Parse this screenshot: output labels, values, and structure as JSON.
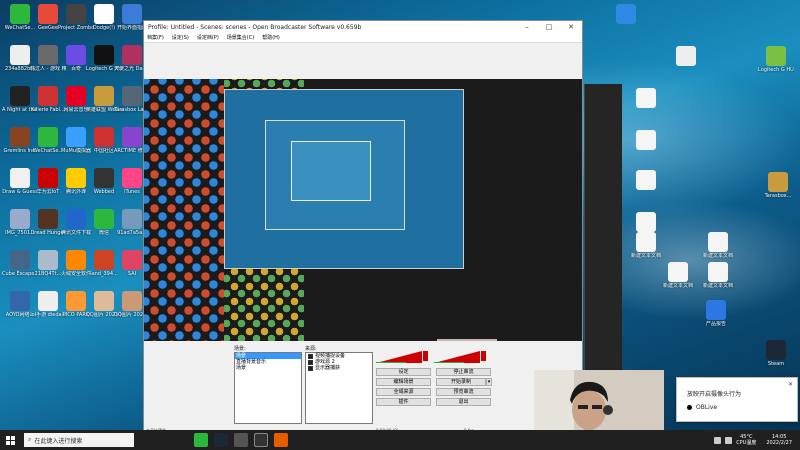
{
  "desktop": {
    "left_icons": [
      {
        "label": "WeChatSe...",
        "color": "#2db83d"
      },
      {
        "label": "GeeGee",
        "color": "#e84a3a"
      },
      {
        "label": "Project Zomboid",
        "color": "#444444"
      },
      {
        "label": "Dodge(!)",
        "color": "#ffffff"
      },
      {
        "label": "开始界面指南",
        "color": "#3c7bd6"
      },
      {
        "label": "234a882b...",
        "color": "#eeeeee"
      },
      {
        "label": "韩过人 - 游戏 精简版",
        "color": "#6a6a6a"
      },
      {
        "label": "百奇",
        "color": "#6b4de6"
      },
      {
        "label": "Logitech G HUB",
        "color": "#111111"
      },
      {
        "label": "天使之光 Dance of Fi...",
        "color": "#b03060"
      },
      {
        "label": "A Night at the Dead",
        "color": "#222222"
      },
      {
        "label": "Killerie Fabl...",
        "color": "#cc3333"
      },
      {
        "label": "网易云音乐",
        "color": "#e60026"
      },
      {
        "label": "英雄联盟 WeGame版",
        "color": "#c89b3c"
      },
      {
        "label": "Tarasbox Launcher v2",
        "color": "#556677"
      },
      {
        "label": "Gremlins Inc.",
        "color": "#884422"
      },
      {
        "label": "WeChatSe...",
        "color": "#2db83d"
      },
      {
        "label": "MuMu模拟器",
        "color": "#3aa0ff"
      },
      {
        "label": "中国社区",
        "color": "#d03030"
      },
      {
        "label": "ARCTIME 修改字幕软件",
        "color": "#8844cc"
      },
      {
        "label": "Draw & Guess",
        "color": "#f0f0f0"
      },
      {
        "label": "华为云IoT",
        "color": "#cc0000"
      },
      {
        "label": "腾讯外课",
        "color": "#ffcc00"
      },
      {
        "label": "Webbed",
        "color": "#333333"
      },
      {
        "label": "iTunes",
        "color": "#ff4488"
      },
      {
        "label": "IMG_7501...",
        "color": "#99aacc"
      },
      {
        "label": "Dread Hunger",
        "color": "#553322"
      },
      {
        "label": "腾讯文件下载",
        "color": "#2266cc"
      },
      {
        "label": "微信",
        "color": "#2db83d"
      },
      {
        "label": "91ad7a5a...",
        "color": "#7799bb"
      },
      {
        "label": "Cube Escape...",
        "color": "#446688"
      },
      {
        "label": "21BQ4Tt...",
        "color": "#aabbcc"
      },
      {
        "label": "火绒安全软件",
        "color": "#ff8800"
      },
      {
        "label": "land_394...",
        "color": "#cc4422"
      },
      {
        "label": "SAI",
        "color": "#dd4466"
      },
      {
        "label": "AOYO网络...",
        "color": "#3366aa"
      },
      {
        "label": "lol手游 diedaili",
        "color": "#eeeeee"
      },
      {
        "label": "PICO PARK",
        "color": "#ff9933"
      },
      {
        "label": "QQ图片 20210820...",
        "color": "#ddbb99"
      },
      {
        "label": "QQ图片 20210818...",
        "color": "#cc9977"
      }
    ],
    "right_icons": [
      {
        "label": "",
        "color": "#2f8ae5"
      },
      {
        "label": "",
        "color": "#eeeeee"
      },
      {
        "label": "Logitech G HUB",
        "color": "#7ac143"
      },
      {
        "label": "",
        "color": "#f5f5f5"
      },
      {
        "label": "",
        "color": "#f5f5f5"
      },
      {
        "label": "",
        "color": "#f5f5f5"
      },
      {
        "label": "Tarasbox... ",
        "color": "#c89b3c"
      },
      {
        "label": "",
        "color": "#f5f5f5"
      },
      {
        "label": "新建文本文档",
        "color": "#f5f5f5"
      },
      {
        "label": "新建文本文档",
        "color": "#f5f5f5"
      },
      {
        "label": "新建文本文档",
        "color": "#f5f5f5"
      },
      {
        "label": "新建文本文档",
        "color": "#f5f5f5"
      },
      {
        "label": "产品报告",
        "color": "#2b78e4"
      },
      {
        "label": "Steam",
        "color": "#1b2838"
      }
    ]
  },
  "obs": {
    "title": "Profile: Untitled - Scenes: scenes - Open Broadcaster Software v0.659b",
    "menu": [
      "档案(F)",
      "设定(S)",
      "设定档(P)",
      "场景集合(C)",
      "帮助(H)"
    ],
    "scenes_label": "场景:",
    "scenes": [
      {
        "name": "场景",
        "selected": true
      },
      {
        "name": "直播背景音乐",
        "selected": false
      },
      {
        "name": "场景",
        "selected": false
      }
    ],
    "sources_label": "来源:",
    "sources": [
      {
        "name": "视频捕捉设备",
        "checked": true
      },
      {
        "name": "游戏源 2",
        "checked": true
      },
      {
        "name": "显示器捕获",
        "checked": true
      }
    ],
    "buttons": {
      "settings": "设定",
      "start_stream": "停止串流",
      "edit_scene": "编辑场景",
      "start_recording": "开始录制",
      "global_sources": "全域来源",
      "preview_stream": "预览串流",
      "plugins": "插件",
      "exit": "退出"
    },
    "status_left": "未开始预览",
    "status_right": "0:00:00 (0)",
    "status_fps": "0 fps"
  },
  "notification": {
    "title": "放映开启摄像头行为",
    "item": "OBLive"
  },
  "taskbar": {
    "search_placeholder": "在此键入进行搜索",
    "temperature": "45°C",
    "temperature_label": "CPU温度",
    "time": "14:05",
    "date": "2022/2/27"
  }
}
